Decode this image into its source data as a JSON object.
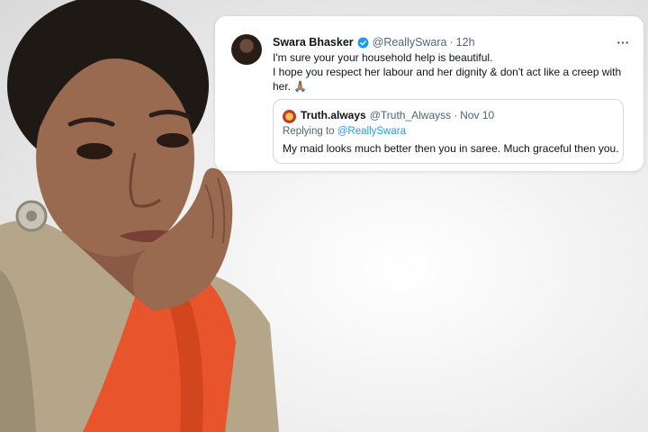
{
  "tweet": {
    "author_name": "Swara Bhasker",
    "handle": "@ReallySwara",
    "separator": "·",
    "time": "12h",
    "text_lines": [
      "I'm sure your your household help is beautiful.",
      "I hope you respect her labour and her dignity & don't act like a creep with",
      "her. 🙏🏽"
    ],
    "quoted": {
      "author_name": "Truth.always",
      "handle": "@Truth_Alwayss",
      "separator": "·",
      "time": "Nov 10",
      "replying_prefix": "Replying to",
      "replying_handle": "@ReallySwara",
      "text": "My maid looks much better then you in saree. Much graceful then you."
    }
  },
  "colors": {
    "verified": "#1d9bf0",
    "saree": "#e8542c",
    "blouse": "#b5a68a"
  }
}
